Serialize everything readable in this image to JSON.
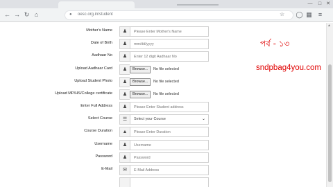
{
  "browser": {
    "url": "oesc.org.in/student",
    "star_icon": "star-icon"
  },
  "form": {
    "fields": [
      {
        "label": "Mother's Name",
        "type": "text",
        "icon": "user-icon",
        "placeholder": "Please Enter Mother's Name"
      },
      {
        "label": "Date of Birth",
        "type": "date",
        "icon": "user-icon",
        "placeholder": "mm/dd/yyyy"
      },
      {
        "label": "Aadhaar No",
        "type": "text",
        "icon": "user-icon",
        "placeholder": "Enter 12 digit Aadhaar No"
      },
      {
        "label": "Upload Aadhaar Card",
        "type": "file",
        "icon": "user-icon",
        "button": "Browse...",
        "status": "No file selected"
      },
      {
        "label": "Upload Student Photo",
        "type": "file",
        "icon": "user-icon",
        "button": "Browse...",
        "status": "No file selected"
      },
      {
        "label": "Upload MP/HS/College certificate",
        "type": "file",
        "icon": "user-icon",
        "button": "Browse...",
        "status": "No file selected"
      },
      {
        "label": "Enter Full Address",
        "type": "text",
        "icon": "user-icon",
        "placeholder": "Please Enter Student address"
      },
      {
        "label": "Select Course",
        "type": "select",
        "icon": "book-icon",
        "value": "Select your Course"
      },
      {
        "label": "Course Duration",
        "type": "text",
        "icon": "graduation-cap-icon",
        "placeholder": "Please Enter Duration"
      },
      {
        "label": "Username",
        "type": "text",
        "icon": "user-icon",
        "placeholder": "Username"
      },
      {
        "label": "Password",
        "type": "password",
        "icon": "user-icon",
        "placeholder": "Password"
      },
      {
        "label": "E-Mail",
        "type": "email",
        "icon": "envelope-icon",
        "placeholder": "E-Mail Address"
      }
    ]
  },
  "overlay": {
    "episode": "পর্ব - ১৩",
    "brand": "sndpbag4you.com"
  },
  "colors": {
    "overlay_text": "#e00000"
  }
}
